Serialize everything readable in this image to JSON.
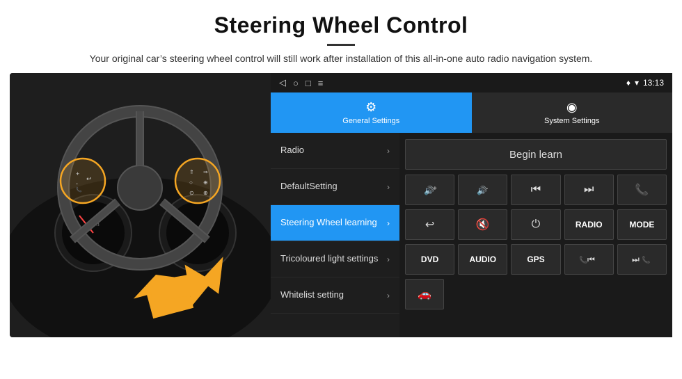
{
  "header": {
    "title": "Steering Wheel Control",
    "subtitle": "Your original car’s steering wheel control will still work after installation of this all-in-one auto radio navigation system."
  },
  "status_bar": {
    "nav_icons": [
      "◁",
      "○",
      "□",
      "≡"
    ],
    "time": "13:13",
    "signal_icons": [
      "♦",
      "▾"
    ]
  },
  "tabs": [
    {
      "label": "General Settings",
      "icon": "⚙",
      "active": true
    },
    {
      "label": "System Settings",
      "icon": "◉",
      "active": false
    }
  ],
  "menu_items": [
    {
      "label": "Radio",
      "active": false
    },
    {
      "label": "DefaultSetting",
      "active": false
    },
    {
      "label": "Steering Wheel learning",
      "active": true
    },
    {
      "label": "Tricoloured light settings",
      "active": false
    },
    {
      "label": "Whitelist setting",
      "active": false
    }
  ],
  "begin_learn_label": "Begin learn",
  "control_buttons_row1": [
    {
      "icon": "🔊+",
      "type": "icon"
    },
    {
      "icon": "🔊-",
      "type": "icon"
    },
    {
      "icon": "⏮",
      "type": "icon"
    },
    {
      "icon": "⏭",
      "type": "icon"
    },
    {
      "icon": "☎",
      "type": "icon"
    }
  ],
  "control_buttons_row2": [
    {
      "icon": "↩",
      "type": "icon"
    },
    {
      "icon": "🔇",
      "type": "icon"
    },
    {
      "icon": "⏻",
      "type": "icon"
    },
    {
      "icon": "RADIO",
      "type": "text"
    },
    {
      "icon": "MODE",
      "type": "text"
    }
  ],
  "control_buttons_row3": [
    {
      "icon": "DVD",
      "type": "text"
    },
    {
      "icon": "AUDIO",
      "type": "text"
    },
    {
      "icon": "GPS",
      "type": "text"
    },
    {
      "icon": "📞⏮",
      "type": "icon"
    },
    {
      "icon": "⏭📞",
      "type": "icon"
    }
  ],
  "bottom_icon": "🚗",
  "chevron": "›"
}
